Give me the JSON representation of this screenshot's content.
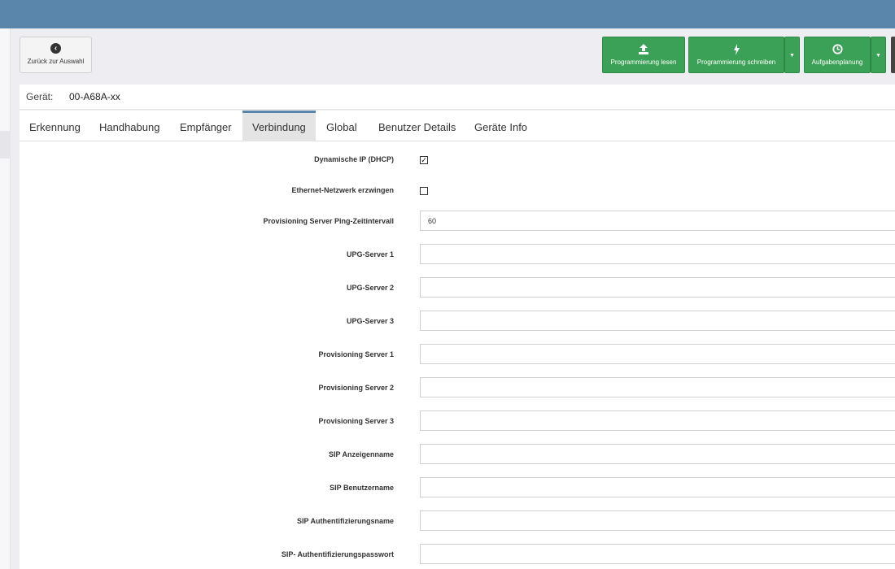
{
  "back_button": {
    "label": "Zurück zur Auswahl",
    "icon": "chevron-left-icon"
  },
  "toolbar": {
    "read_label": "Programmierung lesen",
    "write_label": "Programmierung schreiben",
    "schedule_label": "Aufgabenplanung"
  },
  "device": {
    "label": "Gerät:",
    "value": "00-A68A-xx"
  },
  "tabs": [
    {
      "label": "Erkennung"
    },
    {
      "label": "Handhabung"
    },
    {
      "label": "Empfänger"
    },
    {
      "label": "Verbindung"
    },
    {
      "label": "Global"
    },
    {
      "label": "Benutzer Details"
    },
    {
      "label": "Geräte Info"
    }
  ],
  "active_tab": "Verbindung",
  "form": {
    "dhcp": {
      "label": "Dynamische IP (DHCP)",
      "checked": true
    },
    "ethernet": {
      "label": "Ethernet-Netzwerk erzwingen",
      "checked": false
    },
    "ping_interval": {
      "label": "Provisioning Server Ping-Zeitintervall",
      "value": "60"
    },
    "upg1": {
      "label": "UPG-Server 1",
      "value": ""
    },
    "upg2": {
      "label": "UPG-Server 2",
      "value": ""
    },
    "upg3": {
      "label": "UPG-Server 3",
      "value": ""
    },
    "prov1": {
      "label": "Provisioning Server 1",
      "value": ""
    },
    "prov2": {
      "label": "Provisioning Server 2",
      "value": ""
    },
    "prov3": {
      "label": "Provisioning Server 3",
      "value": ""
    },
    "sip_display": {
      "label": "SIP Anzeigenname",
      "value": ""
    },
    "sip_user": {
      "label": "SIP Benutzername",
      "value": ""
    },
    "sip_auth_name": {
      "label": "SIP Authentifizierungsname",
      "value": ""
    },
    "sip_auth_pass": {
      "label": "SIP- Authentifizierungspasswort",
      "value": ""
    }
  },
  "colors": {
    "header": "#5a86ac",
    "action_green": "#3ba156"
  }
}
